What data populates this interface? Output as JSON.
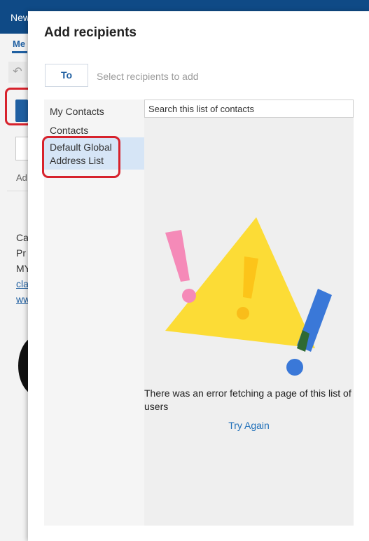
{
  "background_app": {
    "window_title": "New",
    "ribbon_tab": "Me",
    "add_text": "Ad",
    "fragments": [
      "Ca",
      "Pr",
      "MY"
    ],
    "links": [
      "cla",
      "ww"
    ]
  },
  "dialog": {
    "title": "Add recipients",
    "to_label": "To",
    "recipient_placeholder": "Select recipients to add",
    "sidebar": {
      "items": [
        {
          "label": "My Contacts"
        },
        {
          "label": "Contacts"
        },
        {
          "label": "Default Global Address List",
          "selected": true
        }
      ]
    },
    "search_placeholder": "Search this list of contacts",
    "error_message": "There was an error fetching a page of this list of users",
    "try_again_label": "Try Again"
  },
  "colors": {
    "accent": "#1f5fa1",
    "highlight": "#d7222c",
    "selected_bg": "#d6e5f6",
    "warning_yellow": "#fcdc36"
  },
  "icons": {
    "error_illustration": "warning-triangle-icon"
  }
}
